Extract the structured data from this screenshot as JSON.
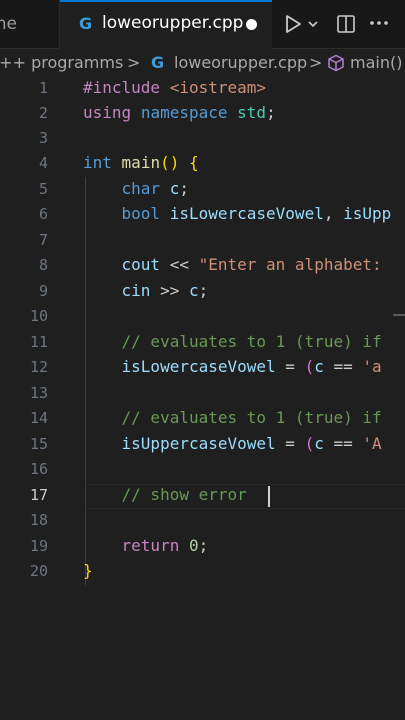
{
  "tabs": {
    "previous_tab_fragment": "me",
    "active_tab_title": "loweorupper.cpp",
    "active_tab_icon": "cpp-file-icon"
  },
  "toolbar": {
    "run_icon": "play-icon",
    "dropdown_icon": "chevron-down-icon",
    "split_icon": "split-editor-icon",
    "more_icon": "ellipsis-icon"
  },
  "breadcrumb": {
    "folder": "C++ programms",
    "sep1": ">",
    "file": "loweorupper.cpp",
    "sep2": ">",
    "symbol": "main()"
  },
  "editor": {
    "active_line": 17,
    "line_numbers": [
      "1",
      "2",
      "3",
      "4",
      "5",
      "6",
      "7",
      "8",
      "9",
      "10",
      "11",
      "12",
      "13",
      "14",
      "15",
      "16",
      "17",
      "18",
      "19",
      "20"
    ],
    "lines": [
      "#include <iostream>",
      "using namespace std;",
      "",
      "int main() {",
      "    char c;",
      "    bool isLowercaseVowel, isUpp",
      "",
      "    cout << \"Enter an alphabet:",
      "    cin >> c;",
      "",
      "    // evaluates to 1 (true) if",
      "    isLowercaseVowel = (c == 'a",
      "",
      "    // evaluates to 1 (true) if",
      "    isUppercaseVowel = (c == 'A",
      "",
      "    // show error ",
      "",
      "    return 0;",
      "}"
    ]
  },
  "colors": {
    "background": "#1f1f1f",
    "accent": "#0078d4",
    "keyword": "#569cd6",
    "comment": "#6a9955",
    "string": "#ce9178"
  }
}
